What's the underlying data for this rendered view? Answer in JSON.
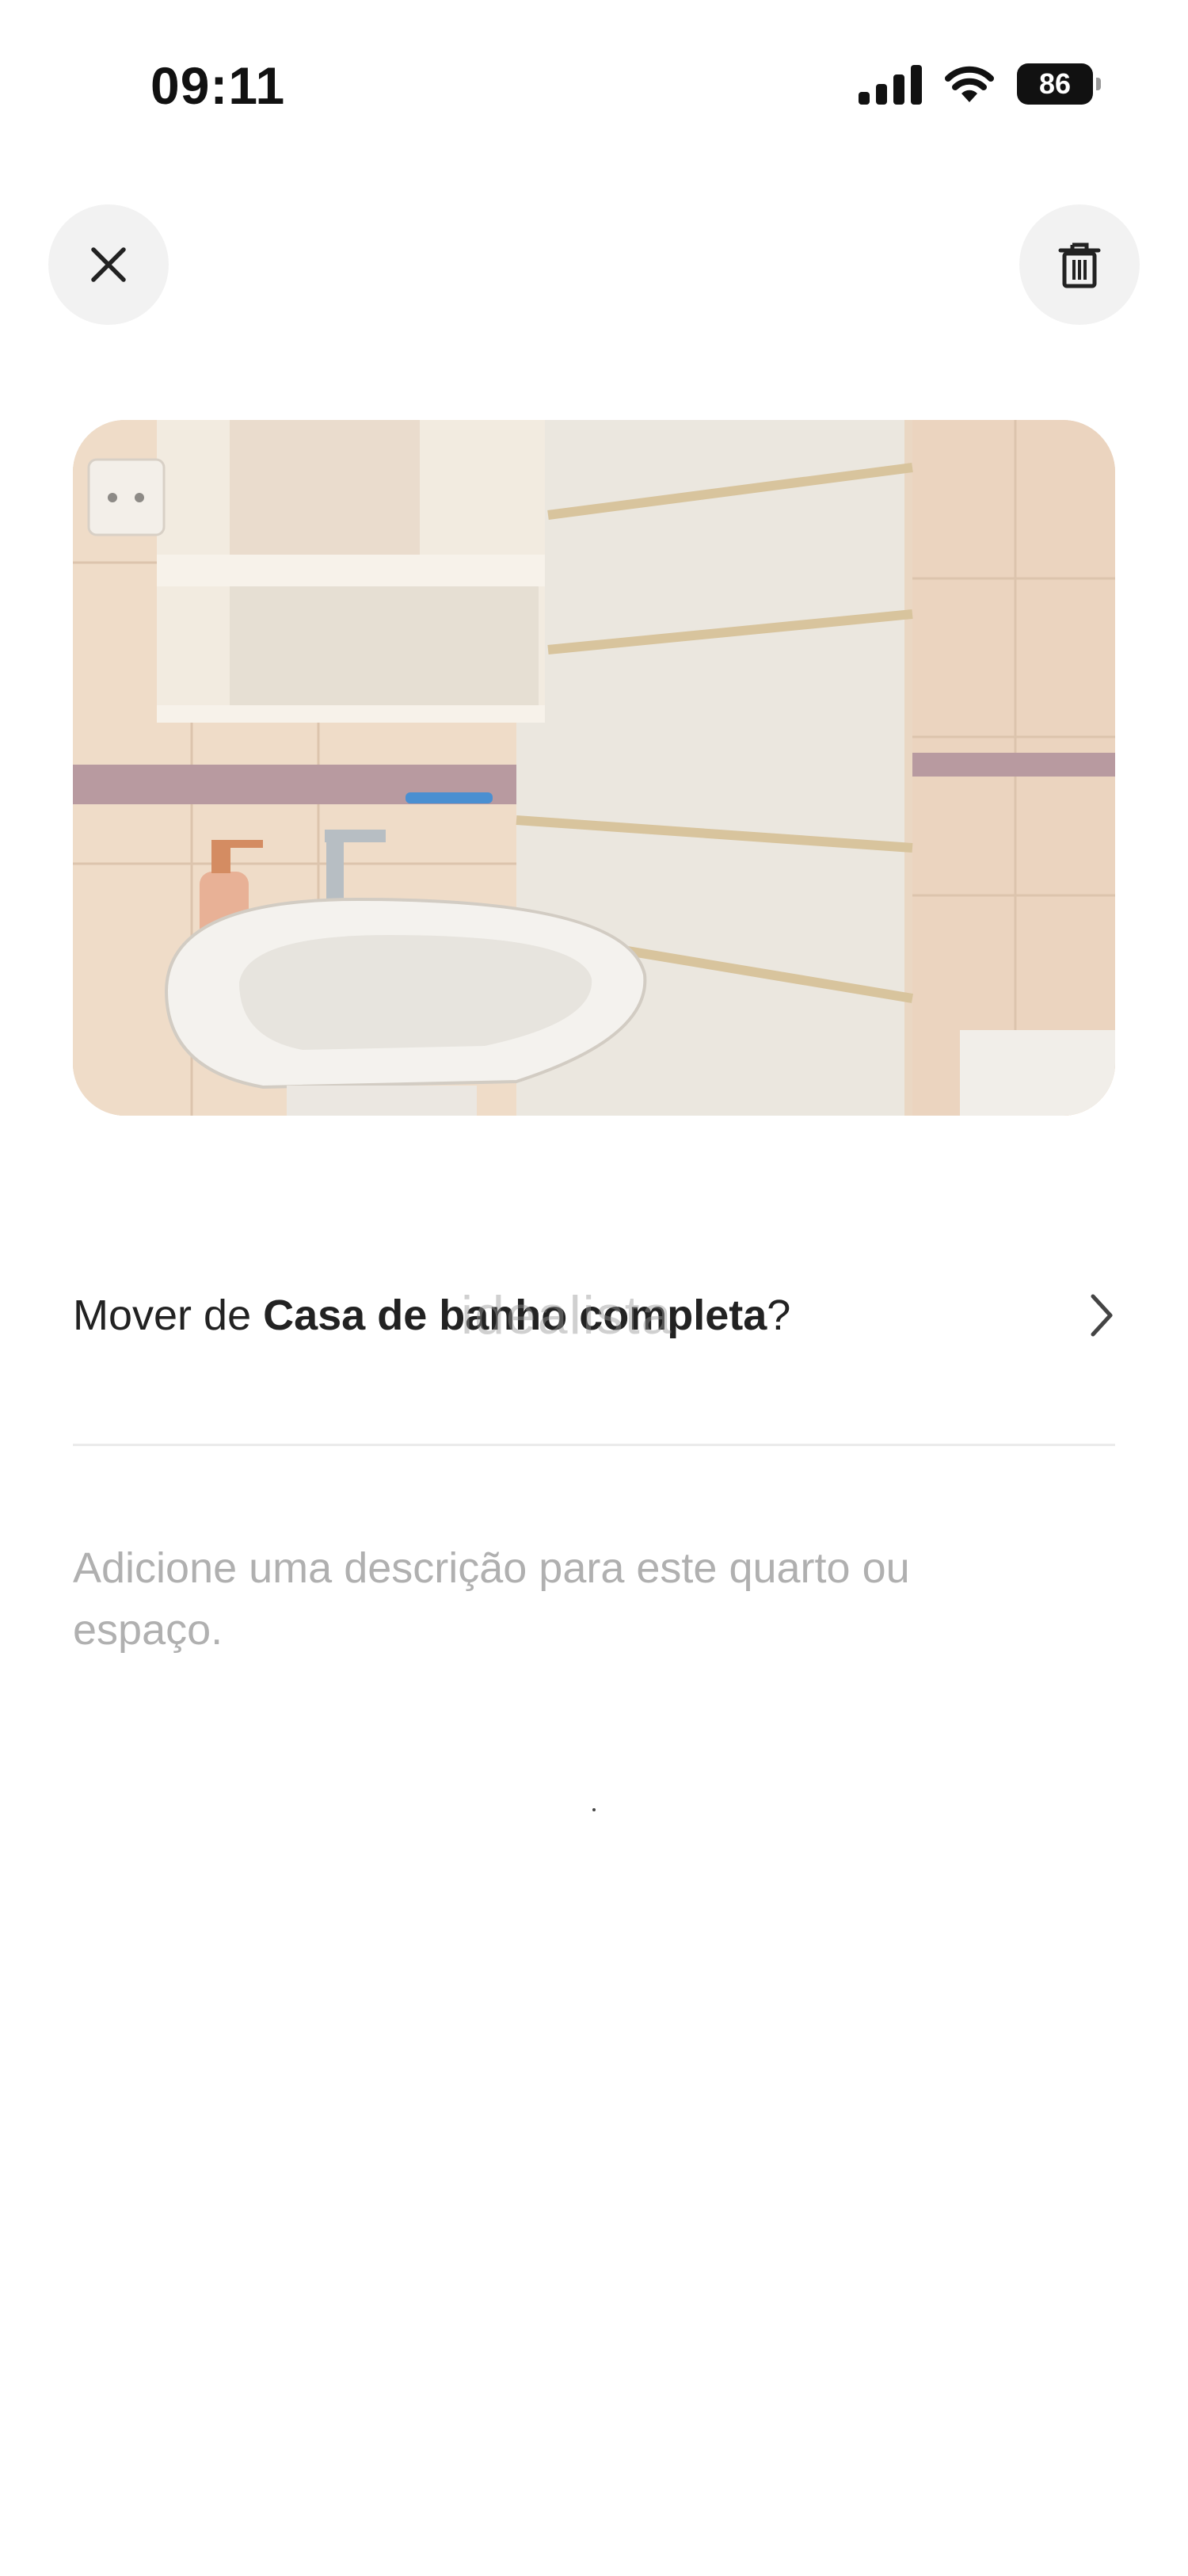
{
  "status_bar": {
    "time": "09:11",
    "battery_level": "86"
  },
  "header": {
    "close_icon": "close-icon",
    "delete_icon": "trash-icon"
  },
  "photo": {
    "watermark": "idealista"
  },
  "move_row": {
    "prefix": "Mover de ",
    "room_name": "Casa de banho completa",
    "suffix": "?",
    "chevron_icon": "chevron-right-icon"
  },
  "description": {
    "placeholder": "Adicione uma descrição para este quarto ou espaço."
  }
}
